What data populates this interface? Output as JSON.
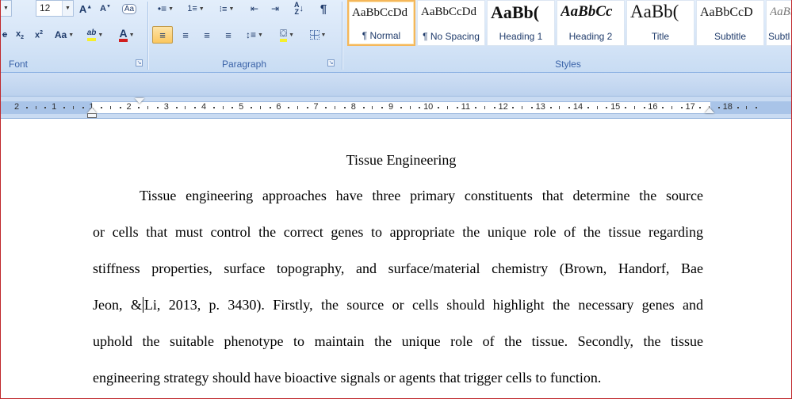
{
  "ribbon": {
    "font": {
      "size_value": "12",
      "group_label": "Font",
      "highlight_color": "#f5ef2c",
      "font_color": "#d11f1f"
    },
    "paragraph": {
      "group_label": "Paragraph",
      "shading_color": "#f5ef2c"
    },
    "styles": {
      "group_label": "Styles",
      "items": [
        {
          "sample": "AaBbCcDd",
          "name": "¶ Normal",
          "selected": true
        },
        {
          "sample": "AaBbCcDd",
          "name": "¶ No Spacing"
        },
        {
          "sample": "AaBb(",
          "name": "Heading 1"
        },
        {
          "sample": "AaBbCc",
          "name": "Heading 2"
        },
        {
          "sample": "AaBb(",
          "name": "Title"
        },
        {
          "sample": "AaBbCcD",
          "name": "Subtitle"
        },
        {
          "sample": "AaBb",
          "name": "Subtl"
        }
      ]
    }
  },
  "ruler": {
    "labels": [
      "2",
      "1",
      "1",
      "2",
      "3",
      "4",
      "5",
      "6",
      "7",
      "8",
      "9",
      "10",
      "11",
      "12",
      "13",
      "14",
      "15",
      "16",
      "17",
      "18"
    ]
  },
  "document": {
    "title": "Tissue Engineering",
    "lines": [
      "Tissue engineering approaches have three primary constituents that determine the source",
      "or cells that must control the correct genes to appropriate the unique role of the tissue regarding",
      "stiffness properties, surface topography, and surface/material chemistry (Brown, Handorf, Bae",
      "Jeon, &",
      "Li, 2013, p. 3430). Firstly, the source or cells should highlight the necessary genes and",
      "uphold the suitable phenotype to maintain the unique role of the tissue. Secondly, the tissue",
      "engineering strategy should have bioactive signals or agents that trigger cells to function."
    ]
  }
}
